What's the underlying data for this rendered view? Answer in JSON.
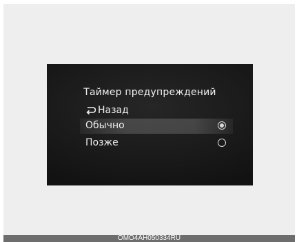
{
  "screen": {
    "title": "Таймер предупреждений",
    "back_label": "Назад",
    "options": [
      {
        "label": "Обычно",
        "selected": true
      },
      {
        "label": "Позже",
        "selected": false
      }
    ]
  },
  "footer": {
    "code": "OMO4AH050334RU"
  },
  "icons": {
    "back": "back-arrow-icon",
    "radio_selected": "radio-selected-icon",
    "radio_unselected": "radio-unselected-icon"
  }
}
